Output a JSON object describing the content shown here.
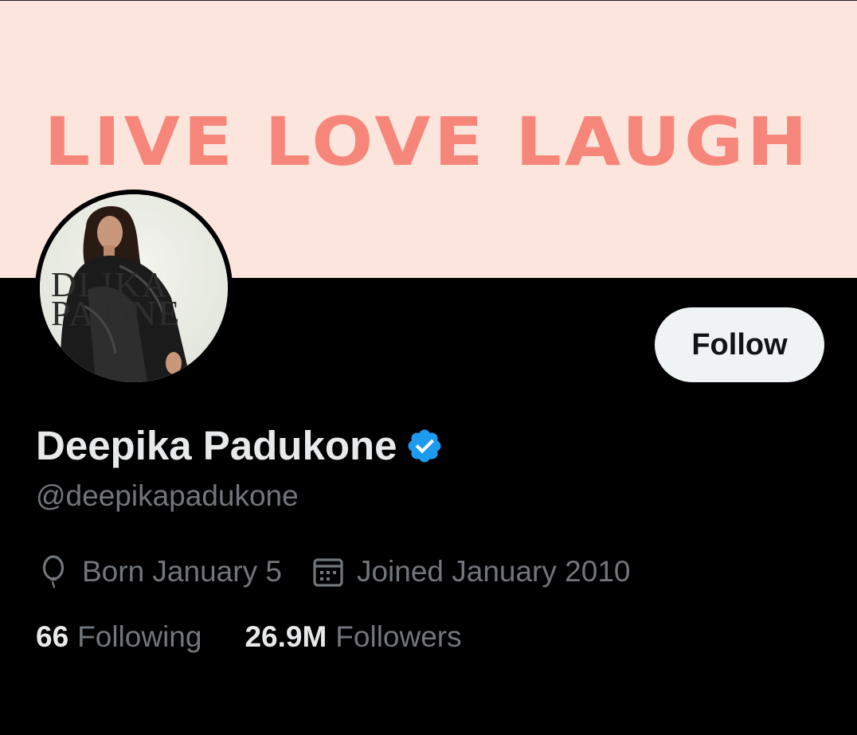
{
  "banner": {
    "text": "LIVE LOVE LAUGH",
    "background_color": "#fce5dc",
    "text_color": "#f7867a"
  },
  "avatar": {
    "logo_line1": "DI  IKA",
    "logo_line2": "PA  ONE"
  },
  "profile": {
    "follow_label": "Follow",
    "display_name": "Deepika Padukone",
    "verified_badge_icon": "verified-badge-icon",
    "verified_color": "#1d9bf0",
    "handle": "@deepikapadukone",
    "birthday_icon": "balloon-icon",
    "birthday": "Born January 5",
    "joined_icon": "calendar-icon",
    "joined": "Joined January 2010",
    "following_count": "66",
    "following_label": "Following",
    "followers_count": "26.9M",
    "followers_label": "Followers"
  },
  "colors": {
    "background": "#000000",
    "primary_text": "#e7e9ea",
    "secondary_text": "#71767b",
    "follow_button_bg": "#eff3f4"
  }
}
